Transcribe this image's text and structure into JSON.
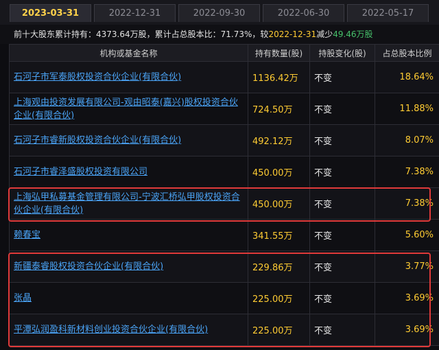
{
  "tabs": [
    {
      "label": "2023-03-31",
      "active": true
    },
    {
      "label": "2022-12-31",
      "active": false
    },
    {
      "label": "2022-09-30",
      "active": false
    },
    {
      "label": "2022-06-30",
      "active": false
    },
    {
      "label": "2022-05-17",
      "active": false
    }
  ],
  "summary": {
    "prefix": "前十大股东累计持有：",
    "total_shares": "4373.64万股",
    "mid": "，累计占总股本比：",
    "total_ratio": "71.73%",
    "cmp": "，较",
    "cmp_date": "2022-12-31",
    "cmp_dir": "减少",
    "cmp_value": "49.46万股"
  },
  "table": {
    "headers": [
      "机构或基金名称",
      "持有数量(股)",
      "持股变化(股)",
      "占总股本比例"
    ],
    "rows": [
      {
        "name": "石河子市军泰股权投资合伙企业(有限合伙)",
        "shares": "1136.42万",
        "change": "不变",
        "ratio": "18.64%"
      },
      {
        "name": "上海观由投资发展有限公司-观由昭泰(嘉兴)股权投资合伙企业(有限合伙)",
        "shares": "724.50万",
        "change": "不变",
        "ratio": "11.88%"
      },
      {
        "name": "石河子市睿新股权投资合伙企业(有限合伙)",
        "shares": "492.12万",
        "change": "不变",
        "ratio": "8.07%"
      },
      {
        "name": "石河子市睿泽盛股权投资有限公司",
        "shares": "450.00万",
        "change": "不变",
        "ratio": "7.38%"
      },
      {
        "name": "上海弘甲私募基金管理有限公司-宁波汇桥弘甲股权投资合伙企业(有限合伙)",
        "shares": "450.00万",
        "change": "不变",
        "ratio": "7.38%"
      },
      {
        "name": "赖春宝",
        "shares": "341.55万",
        "change": "不变",
        "ratio": "5.60%"
      },
      {
        "name": "新疆泰睿股权投资合伙企业(有限合伙)",
        "shares": "229.86万",
        "change": "不变",
        "ratio": "3.77%"
      },
      {
        "name": "张晶",
        "shares": "225.00万",
        "change": "不变",
        "ratio": "3.69%"
      },
      {
        "name": "平潭弘润盈科新材料创业投资合伙企业(有限合伙)",
        "shares": "225.00万",
        "change": "不变",
        "ratio": "3.69%"
      }
    ]
  },
  "colors": {
    "background": "#0d0d11",
    "link": "#4aa3f5",
    "accent_yellow": "#ffcc33",
    "decrease_green": "#46c06a",
    "highlight_red": "#e03a3a"
  }
}
